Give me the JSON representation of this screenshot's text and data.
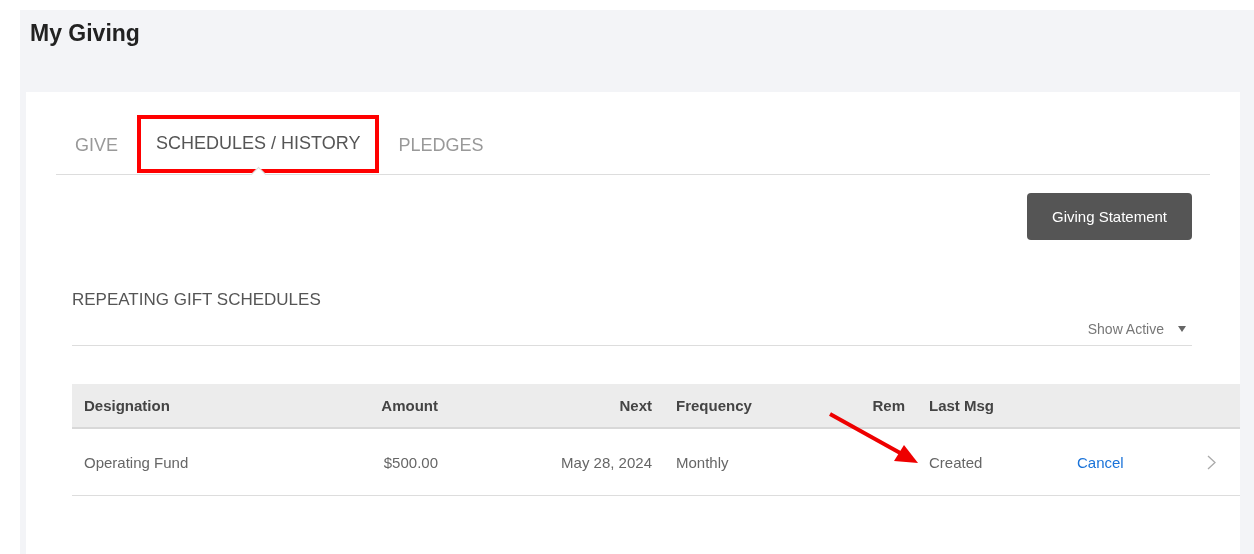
{
  "page": {
    "title": "My Giving"
  },
  "tabs": [
    {
      "label": "GIVE",
      "selected": false,
      "highlighted": false
    },
    {
      "label": "SCHEDULES / HISTORY",
      "selected": true,
      "highlighted": true
    },
    {
      "label": "PLEDGES",
      "selected": false,
      "highlighted": false
    }
  ],
  "statement_button": "Giving Statement",
  "section": {
    "title": "REPEATING GIFT SCHEDULES",
    "filter": "Show Active"
  },
  "table": {
    "columns": [
      "Designation",
      "Amount",
      "Next",
      "Frequency",
      "Rem",
      "Last Msg"
    ],
    "rows": [
      {
        "cells": [
          "Operating Fund",
          "$500.00",
          "May 28, 2024",
          "Monthly",
          "",
          "Created"
        ],
        "action": "Cancel",
        "arrow_pointing": true
      }
    ]
  }
}
